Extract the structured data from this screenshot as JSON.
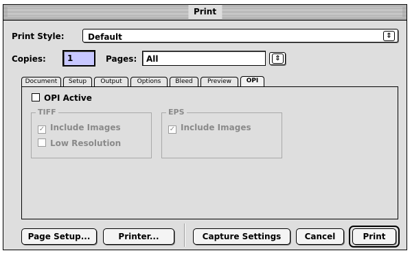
{
  "window": {
    "title": "Print"
  },
  "print_style": {
    "label": "Print Style:",
    "value": "Default"
  },
  "copies": {
    "label": "Copies:",
    "value": "1"
  },
  "pages": {
    "label": "Pages:",
    "value": "All"
  },
  "tabs": [
    {
      "label": "Document"
    },
    {
      "label": "Setup"
    },
    {
      "label": "Output"
    },
    {
      "label": "Options"
    },
    {
      "label": "Bleed"
    },
    {
      "label": "Preview"
    },
    {
      "label": "OPI",
      "active": true
    }
  ],
  "opi": {
    "opi_active": {
      "label": "OPI Active",
      "checked": false
    },
    "tiff": {
      "title": "TIFF",
      "include_images": {
        "label": "Include Images",
        "checked": true,
        "enabled": false
      },
      "low_resolution": {
        "label": "Low Resolution",
        "checked": false,
        "enabled": false
      }
    },
    "eps": {
      "title": "EPS",
      "include_images": {
        "label": "Include Images",
        "checked": true,
        "enabled": false
      }
    }
  },
  "buttons": {
    "page_setup": "Page Setup...",
    "printer": "Printer...",
    "capture_settings": "Capture Settings",
    "cancel": "Cancel",
    "print": "Print"
  },
  "icons": {
    "popup_arrow": "up-down-arrows-icon",
    "checkmark": "checkmark-icon"
  }
}
